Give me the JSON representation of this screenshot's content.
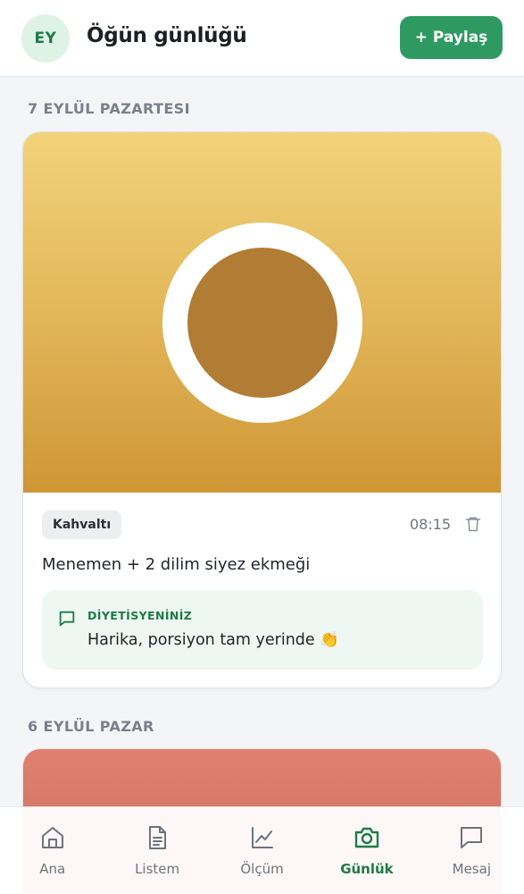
{
  "header": {
    "avatar_initials": "EY",
    "title": "Öğün günlüğü",
    "share_label": "+ Paylaş"
  },
  "days": [
    {
      "date_label": "7 EYLÜL PAZARTESI",
      "entry": {
        "meal_type": "Kahvaltı",
        "time": "08:15",
        "description": "Menemen + 2 dilim siyez ekmeği",
        "photo_colors": [
          "#f3d27a",
          "#cf9636"
        ],
        "comment": {
          "label": "DİYETİSYENİNİZ",
          "text": "Harika, porsiyon tam yerinde 👏"
        }
      }
    },
    {
      "date_label": "6 EYLÜL PAZAR",
      "entry": {
        "photo_colors": [
          "#df8070",
          "#c86a58"
        ]
      }
    }
  ],
  "tabbar": {
    "items": [
      {
        "label": "Ana",
        "icon": "home-icon",
        "active": false
      },
      {
        "label": "Listem",
        "icon": "list-icon",
        "active": false
      },
      {
        "label": "Ölçüm",
        "icon": "chart-icon",
        "active": false
      },
      {
        "label": "Günlük",
        "icon": "camera-icon",
        "active": true
      },
      {
        "label": "Mesaj",
        "icon": "message-icon",
        "active": false
      }
    ]
  },
  "colors": {
    "accent": "#2e9a62",
    "accent_dark": "#1f7a47",
    "background": "#f4f5f7"
  }
}
